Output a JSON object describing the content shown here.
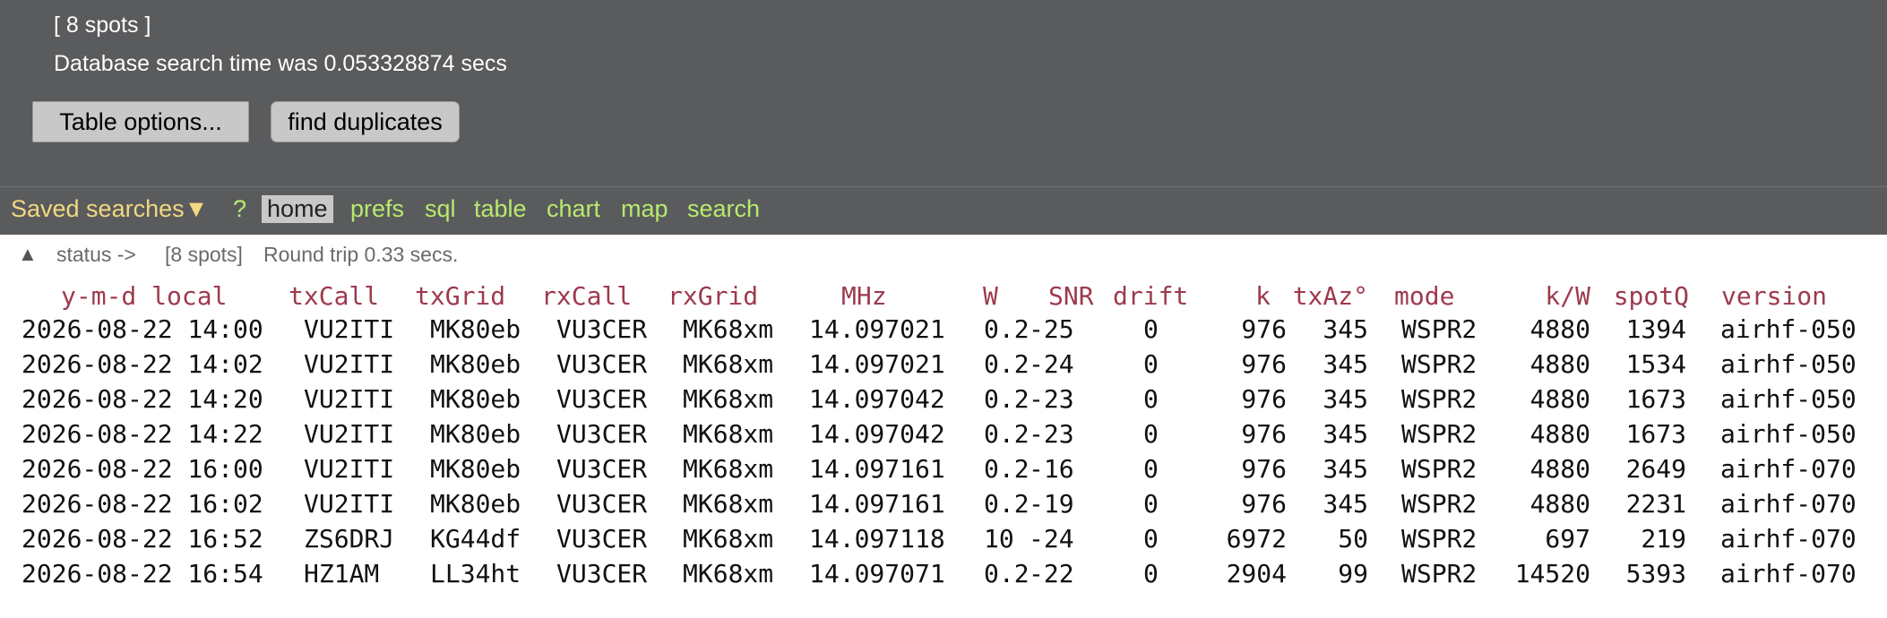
{
  "summary": {
    "spots": "[ 8 spots ]",
    "search_time": "Database search time was  0.053328874 secs"
  },
  "buttons": {
    "table_options": "Table options...",
    "find_duplicates": "find duplicates"
  },
  "nav": {
    "saved_searches": "Saved searches▼",
    "help": "?",
    "items": [
      "home",
      "prefs",
      "sql",
      "table",
      "chart",
      "map",
      "search"
    ],
    "active": "home"
  },
  "status": {
    "caret": "▲",
    "label": "status ->",
    "spots": "[8 spots]",
    "round_trip": "Round trip 0.33 secs."
  },
  "table": {
    "headers": [
      "y-m-d local",
      "txCall",
      "txGrid",
      "rxCall",
      "rxGrid",
      "MHz",
      "W",
      "SNR",
      "drift",
      "k",
      "txAz°",
      "mode",
      "k/W",
      "spotQ",
      "version"
    ],
    "rows": [
      [
        "2026-08-22 14:00",
        "VU2ITI",
        "MK80eb",
        "VU3CER",
        "MK68xm",
        "14.097021",
        "0.2",
        "-25",
        "0",
        "976",
        "345",
        "WSPR2",
        "4880",
        "1394",
        "airhf-050"
      ],
      [
        "2026-08-22 14:02",
        "VU2ITI",
        "MK80eb",
        "VU3CER",
        "MK68xm",
        "14.097021",
        "0.2",
        "-24",
        "0",
        "976",
        "345",
        "WSPR2",
        "4880",
        "1534",
        "airhf-050"
      ],
      [
        "2026-08-22 14:20",
        "VU2ITI",
        "MK80eb",
        "VU3CER",
        "MK68xm",
        "14.097042",
        "0.2",
        "-23",
        "0",
        "976",
        "345",
        "WSPR2",
        "4880",
        "1673",
        "airhf-050"
      ],
      [
        "2026-08-22 14:22",
        "VU2ITI",
        "MK80eb",
        "VU3CER",
        "MK68xm",
        "14.097042",
        "0.2",
        "-23",
        "0",
        "976",
        "345",
        "WSPR2",
        "4880",
        "1673",
        "airhf-050"
      ],
      [
        "2026-08-22 16:00",
        "VU2ITI",
        "MK80eb",
        "VU3CER",
        "MK68xm",
        "14.097161",
        "0.2",
        "-16",
        "0",
        "976",
        "345",
        "WSPR2",
        "4880",
        "2649",
        "airhf-070"
      ],
      [
        "2026-08-22 16:02",
        "VU2ITI",
        "MK80eb",
        "VU3CER",
        "MK68xm",
        "14.097161",
        "0.2",
        "-19",
        "0",
        "976",
        "345",
        "WSPR2",
        "4880",
        "2231",
        "airhf-070"
      ],
      [
        "2026-08-22 16:52",
        "ZS6DRJ",
        "KG44df",
        "VU3CER",
        "MK68xm",
        "14.097118",
        "10",
        "-24",
        "0",
        "6972",
        "50",
        "WSPR2",
        "697",
        "219",
        "airhf-070"
      ],
      [
        "2026-08-22 16:54",
        "HZ1AM",
        "LL34ht",
        "VU3CER",
        "MK68xm",
        "14.097071",
        "0.2",
        "-22",
        "0",
        "2904",
        "99",
        "WSPR2",
        "14520",
        "5393",
        "airhf-070"
      ]
    ]
  }
}
